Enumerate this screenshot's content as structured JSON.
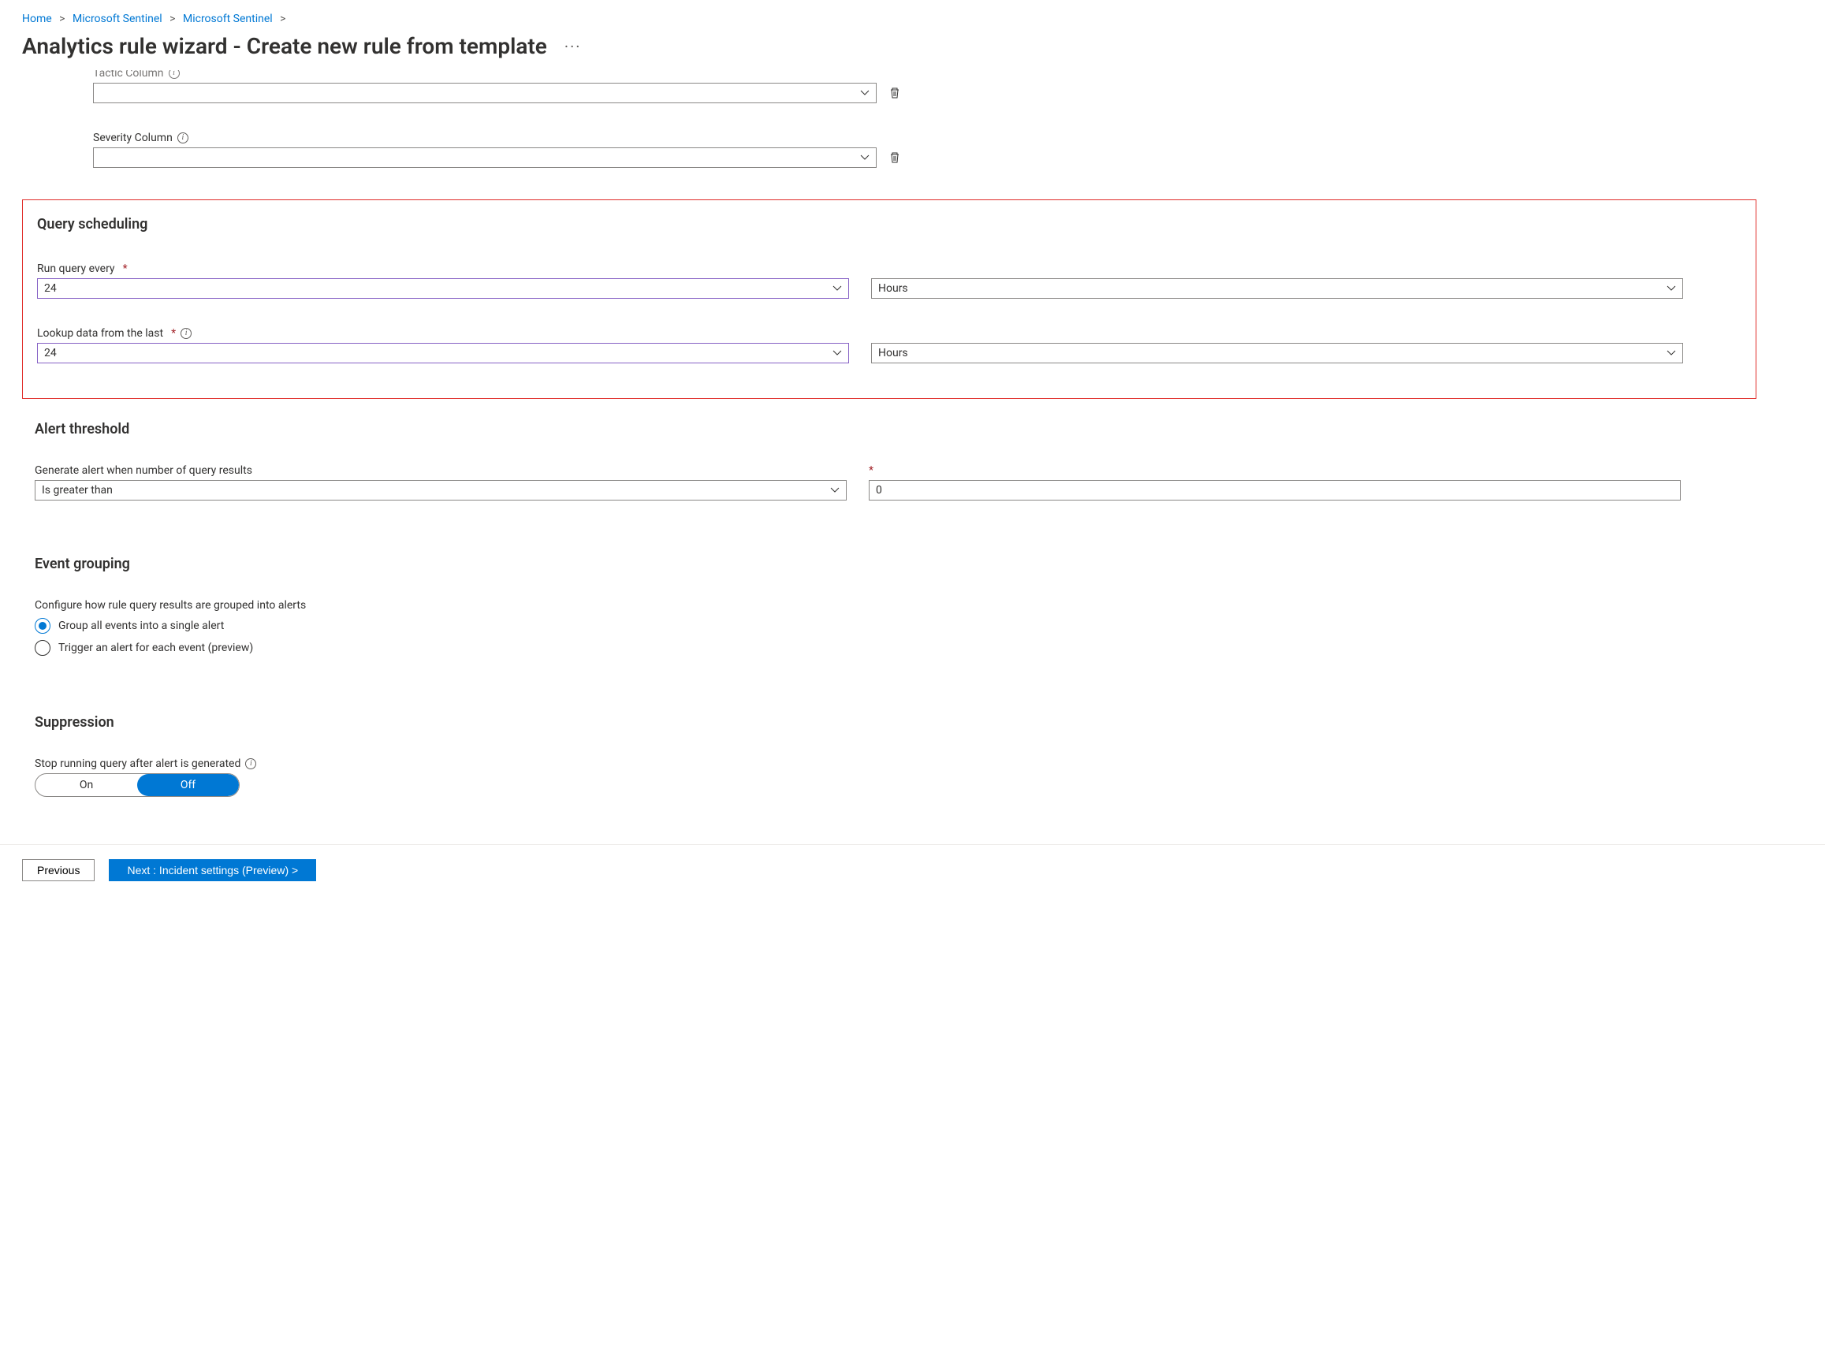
{
  "breadcrumb": {
    "items": [
      "Home",
      "Microsoft Sentinel",
      "Microsoft Sentinel"
    ]
  },
  "page": {
    "title": "Analytics rule wizard - Create new rule from template"
  },
  "columnFields": {
    "tactic": {
      "label": "Tactic Column",
      "value": ""
    },
    "severity": {
      "label": "Severity Column",
      "value": ""
    }
  },
  "scheduling": {
    "heading": "Query scheduling",
    "runEvery": {
      "label": "Run query every",
      "value": "24",
      "unit": "Hours"
    },
    "lookup": {
      "label": "Lookup data from the last",
      "value": "24",
      "unit": "Hours"
    }
  },
  "threshold": {
    "heading": "Alert threshold",
    "label": "Generate alert when number of query results",
    "operator": "Is greater than",
    "value": "0"
  },
  "grouping": {
    "heading": "Event grouping",
    "label": "Configure how rule query results are grouped into alerts",
    "options": {
      "single": "Group all events into a single alert",
      "each": "Trigger an alert for each event (preview)"
    }
  },
  "suppression": {
    "heading": "Suppression",
    "label": "Stop running query after alert is generated",
    "on": "On",
    "off": "Off"
  },
  "footer": {
    "previous": "Previous",
    "next": "Next : Incident settings (Preview) >"
  }
}
